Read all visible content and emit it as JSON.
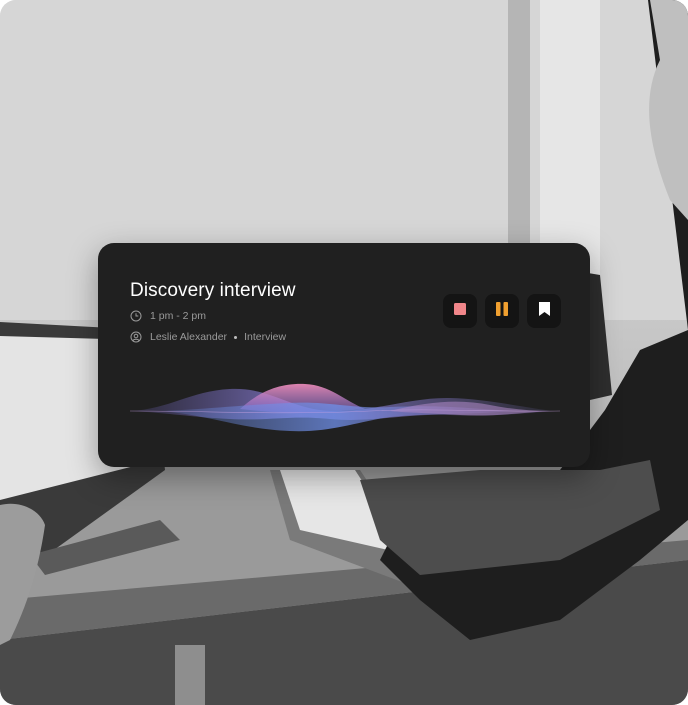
{
  "card": {
    "title": "Discovery interview",
    "time": "1 pm - 2 pm",
    "person": "Leslie Alexander",
    "category": "Interview"
  },
  "controls": {
    "stop": {
      "icon": "stop-icon",
      "color": "#f0868a"
    },
    "pause": {
      "icon": "pause-icon",
      "color": "#f0a030"
    },
    "bookmark": {
      "icon": "bookmark-icon",
      "color": "#ffffff"
    }
  },
  "colors": {
    "card_bg": "#202020",
    "control_bg": "#141414",
    "wave_pink": "#e889b6",
    "wave_purple": "#8a7fd6",
    "wave_blue": "#6f8fe8"
  }
}
